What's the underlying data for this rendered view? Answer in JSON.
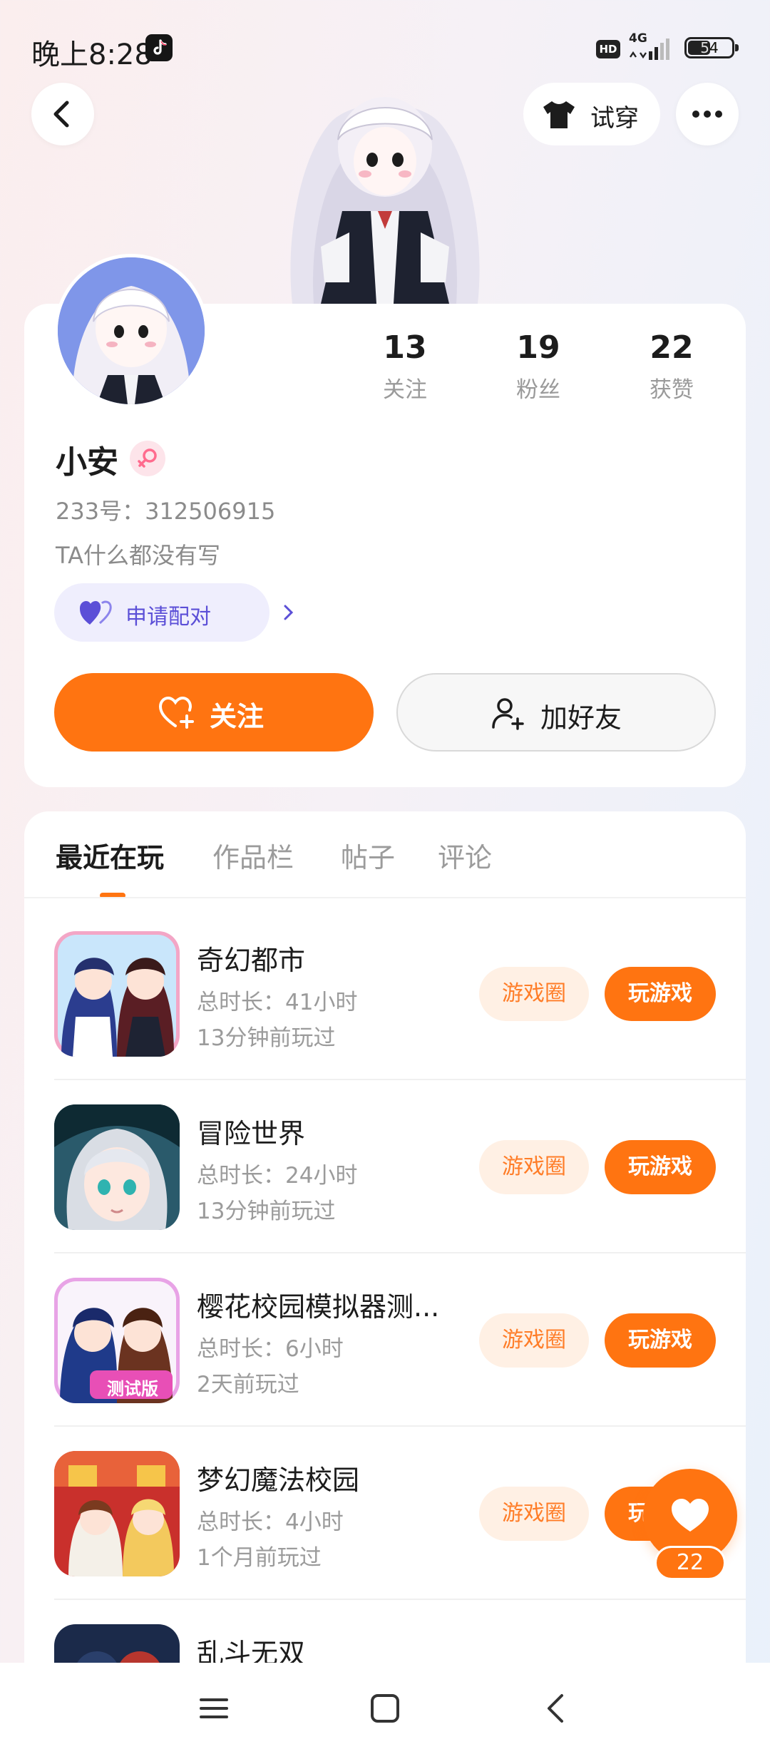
{
  "status_bar": {
    "time": "晚上8:28",
    "hd": "HD",
    "network": "4G",
    "battery": "54",
    "battery_level": 0.54
  },
  "header": {
    "tryon_label": "试穿"
  },
  "profile": {
    "stats": [
      {
        "value": "13",
        "label": "关注"
      },
      {
        "value": "19",
        "label": "粉丝"
      },
      {
        "value": "22",
        "label": "获赞"
      }
    ],
    "username": "小安",
    "uid": "233号：312506915",
    "bio": "TA什么都没有写",
    "pair_label": "申请配对",
    "follow_label": "关注",
    "add_friend_label": "加好友"
  },
  "tabs": [
    "最近在玩",
    "作品栏",
    "帖子",
    "评论"
  ],
  "games": [
    {
      "name": "奇幻都市",
      "duration": "总时长：41小时",
      "last_played": "13分钟前玩过",
      "circle_label": "游戏圈",
      "play_label": "玩游戏"
    },
    {
      "name": "冒险世界",
      "duration": "总时长：24小时",
      "last_played": "13分钟前玩过",
      "circle_label": "游戏圈",
      "play_label": "玩游戏"
    },
    {
      "name": "樱花校园模拟器测...",
      "duration": "总时长：6小时",
      "last_played": "2天前玩过",
      "circle_label": "游戏圈",
      "play_label": "玩游戏",
      "badge": "测试版"
    },
    {
      "name": "梦幻魔法校园",
      "duration": "总时长：4小时",
      "last_played": "1个月前玩过",
      "circle_label": "游戏圈",
      "play_label": "玩游戏"
    },
    {
      "name": "乱斗无双",
      "duration": "",
      "last_played": "",
      "circle_label": "",
      "play_label": ""
    }
  ],
  "like_fab": {
    "count": "22"
  },
  "colors": {
    "accent": "#ff7411",
    "pair_bg": "#efeefd",
    "pair_text": "#5b4fd7"
  }
}
